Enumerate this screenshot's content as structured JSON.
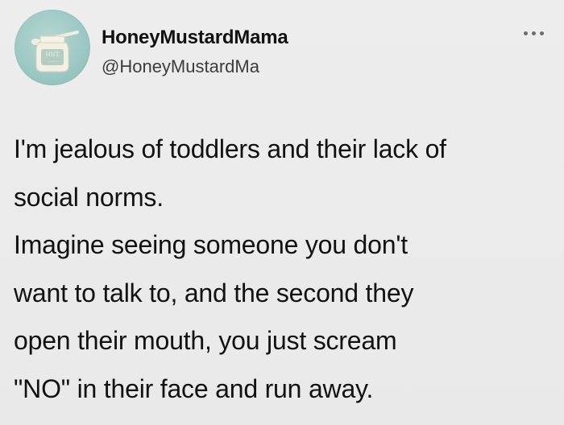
{
  "tweet": {
    "author": {
      "display_name": "HoneyMustardMama",
      "handle": "@HoneyMustardMa",
      "avatar": {
        "icon": "honey-jar-icon",
        "label_text": "HNT",
        "background_color": "#9cc9c4"
      }
    },
    "more_options_icon": "more-horizontal-icon",
    "text_lines": [
      "I'm jealous of toddlers and their lack of",
      "social norms.",
      "Imagine seeing someone you don't",
      "want to talk to, and the second they",
      "open their mouth, you just scream",
      "\"NO\" in their face and run away."
    ]
  },
  "colors": {
    "background": "#ebebeb",
    "text": "#121212",
    "handle": "#3c3c3c",
    "avatar_bg": "#9cc9c4"
  }
}
